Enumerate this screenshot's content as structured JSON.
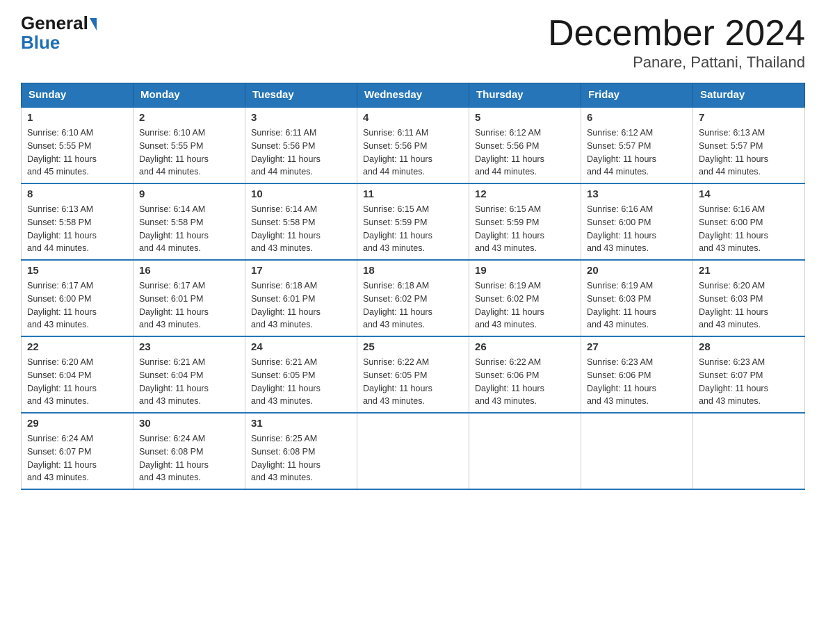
{
  "header": {
    "logo_general": "General",
    "logo_blue": "Blue",
    "month_title": "December 2024",
    "location": "Panare, Pattani, Thailand"
  },
  "days_of_week": [
    "Sunday",
    "Monday",
    "Tuesday",
    "Wednesday",
    "Thursday",
    "Friday",
    "Saturday"
  ],
  "weeks": [
    [
      {
        "day": "1",
        "sunrise": "6:10 AM",
        "sunset": "5:55 PM",
        "daylight": "11 hours and 45 minutes."
      },
      {
        "day": "2",
        "sunrise": "6:10 AM",
        "sunset": "5:55 PM",
        "daylight": "11 hours and 44 minutes."
      },
      {
        "day": "3",
        "sunrise": "6:11 AM",
        "sunset": "5:56 PM",
        "daylight": "11 hours and 44 minutes."
      },
      {
        "day": "4",
        "sunrise": "6:11 AM",
        "sunset": "5:56 PM",
        "daylight": "11 hours and 44 minutes."
      },
      {
        "day": "5",
        "sunrise": "6:12 AM",
        "sunset": "5:56 PM",
        "daylight": "11 hours and 44 minutes."
      },
      {
        "day": "6",
        "sunrise": "6:12 AM",
        "sunset": "5:57 PM",
        "daylight": "11 hours and 44 minutes."
      },
      {
        "day": "7",
        "sunrise": "6:13 AM",
        "sunset": "5:57 PM",
        "daylight": "11 hours and 44 minutes."
      }
    ],
    [
      {
        "day": "8",
        "sunrise": "6:13 AM",
        "sunset": "5:58 PM",
        "daylight": "11 hours and 44 minutes."
      },
      {
        "day": "9",
        "sunrise": "6:14 AM",
        "sunset": "5:58 PM",
        "daylight": "11 hours and 44 minutes."
      },
      {
        "day": "10",
        "sunrise": "6:14 AM",
        "sunset": "5:58 PM",
        "daylight": "11 hours and 43 minutes."
      },
      {
        "day": "11",
        "sunrise": "6:15 AM",
        "sunset": "5:59 PM",
        "daylight": "11 hours and 43 minutes."
      },
      {
        "day": "12",
        "sunrise": "6:15 AM",
        "sunset": "5:59 PM",
        "daylight": "11 hours and 43 minutes."
      },
      {
        "day": "13",
        "sunrise": "6:16 AM",
        "sunset": "6:00 PM",
        "daylight": "11 hours and 43 minutes."
      },
      {
        "day": "14",
        "sunrise": "6:16 AM",
        "sunset": "6:00 PM",
        "daylight": "11 hours and 43 minutes."
      }
    ],
    [
      {
        "day": "15",
        "sunrise": "6:17 AM",
        "sunset": "6:00 PM",
        "daylight": "11 hours and 43 minutes."
      },
      {
        "day": "16",
        "sunrise": "6:17 AM",
        "sunset": "6:01 PM",
        "daylight": "11 hours and 43 minutes."
      },
      {
        "day": "17",
        "sunrise": "6:18 AM",
        "sunset": "6:01 PM",
        "daylight": "11 hours and 43 minutes."
      },
      {
        "day": "18",
        "sunrise": "6:18 AM",
        "sunset": "6:02 PM",
        "daylight": "11 hours and 43 minutes."
      },
      {
        "day": "19",
        "sunrise": "6:19 AM",
        "sunset": "6:02 PM",
        "daylight": "11 hours and 43 minutes."
      },
      {
        "day": "20",
        "sunrise": "6:19 AM",
        "sunset": "6:03 PM",
        "daylight": "11 hours and 43 minutes."
      },
      {
        "day": "21",
        "sunrise": "6:20 AM",
        "sunset": "6:03 PM",
        "daylight": "11 hours and 43 minutes."
      }
    ],
    [
      {
        "day": "22",
        "sunrise": "6:20 AM",
        "sunset": "6:04 PM",
        "daylight": "11 hours and 43 minutes."
      },
      {
        "day": "23",
        "sunrise": "6:21 AM",
        "sunset": "6:04 PM",
        "daylight": "11 hours and 43 minutes."
      },
      {
        "day": "24",
        "sunrise": "6:21 AM",
        "sunset": "6:05 PM",
        "daylight": "11 hours and 43 minutes."
      },
      {
        "day": "25",
        "sunrise": "6:22 AM",
        "sunset": "6:05 PM",
        "daylight": "11 hours and 43 minutes."
      },
      {
        "day": "26",
        "sunrise": "6:22 AM",
        "sunset": "6:06 PM",
        "daylight": "11 hours and 43 minutes."
      },
      {
        "day": "27",
        "sunrise": "6:23 AM",
        "sunset": "6:06 PM",
        "daylight": "11 hours and 43 minutes."
      },
      {
        "day": "28",
        "sunrise": "6:23 AM",
        "sunset": "6:07 PM",
        "daylight": "11 hours and 43 minutes."
      }
    ],
    [
      {
        "day": "29",
        "sunrise": "6:24 AM",
        "sunset": "6:07 PM",
        "daylight": "11 hours and 43 minutes."
      },
      {
        "day": "30",
        "sunrise": "6:24 AM",
        "sunset": "6:08 PM",
        "daylight": "11 hours and 43 minutes."
      },
      {
        "day": "31",
        "sunrise": "6:25 AM",
        "sunset": "6:08 PM",
        "daylight": "11 hours and 43 minutes."
      },
      null,
      null,
      null,
      null
    ]
  ],
  "labels": {
    "sunrise": "Sunrise:",
    "sunset": "Sunset:",
    "daylight": "Daylight:"
  }
}
